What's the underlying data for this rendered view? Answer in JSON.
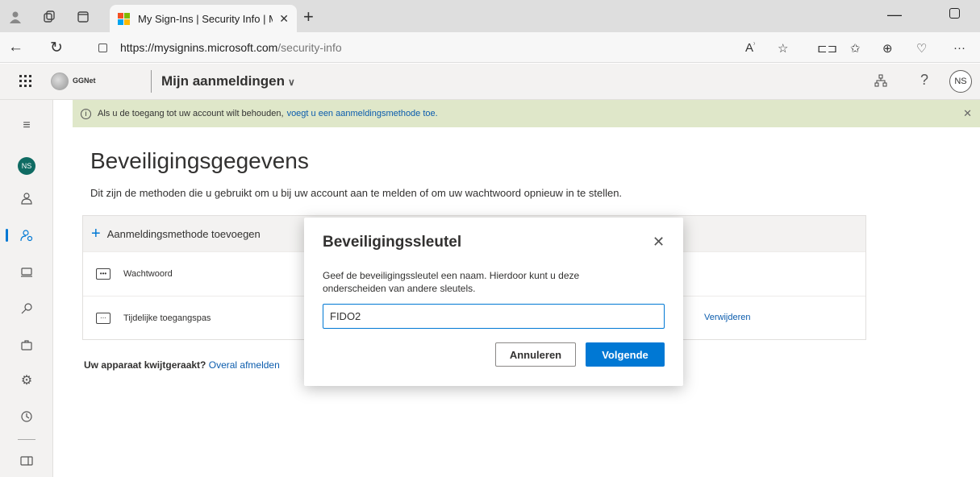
{
  "browser": {
    "tab_title": "My Sign-Ins | Security Info | Micr",
    "url_host": "https://mysignins.microsoft.com",
    "url_path": "/security-info"
  },
  "header": {
    "org_name": "GGNet",
    "app_title": "Mijn aanmeldingen",
    "avatar_initials": "NS"
  },
  "rail": {
    "avatar_initials": "NS"
  },
  "banner": {
    "text": "Als u de toegang tot uw account wilt behouden,",
    "link": "voegt u een aanmeldingsmethode toe."
  },
  "main": {
    "title": "Beveiligingsgegevens",
    "description": "Dit zijn de methoden die u gebruikt om u bij uw account aan te melden of om uw wachtwoord opnieuw in te stellen.",
    "add_method_label": "Aanmeldingsmethode toevoegen",
    "methods": [
      {
        "label": "Wachtwoord",
        "icon": "password-icon"
      },
      {
        "label": "Tijdelijke toegangspas",
        "icon": "temporary-access-pass-icon",
        "action": "Verwijderen"
      }
    ],
    "lost_device_text": "Uw apparaat kwijtgeraakt?",
    "lost_device_link": "Overal afmelden"
  },
  "dialog": {
    "title": "Beveiligingssleutel",
    "description": "Geef de beveiligingssleutel een naam. Hierdoor kunt u deze onderscheiden van andere sleutels.",
    "input_value": "FIDO2",
    "cancel_label": "Annuleren",
    "next_label": "Volgende"
  },
  "colors": {
    "accent": "#0078d4",
    "banner_bg": "#dfe7c9",
    "rail_avatar": "#0f6b63"
  }
}
